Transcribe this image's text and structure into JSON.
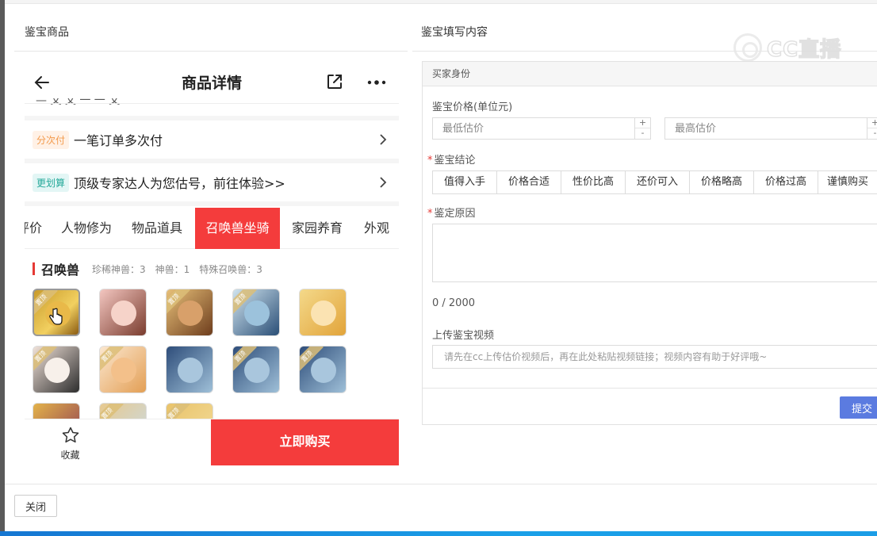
{
  "left_section": {
    "title": "鉴宝商品"
  },
  "right_section": {
    "title": "鉴宝填写内容"
  },
  "watermark": {
    "text": "CC直播"
  },
  "phone": {
    "nav_title": "商品详情",
    "cutoff_text": "— 乂 乂 一 一 乂",
    "rows": [
      {
        "tag": "分次付",
        "text": "一笔订单多次付"
      },
      {
        "tag": "更划算",
        "text": "顶级专家达人为您估号，前往体验>>"
      }
    ],
    "tabs": [
      "评价",
      "人物修为",
      "物品道具",
      "召唤兽坐骑",
      "家园养育",
      "外观"
    ],
    "active_tab": "召唤兽坐骑",
    "pet_section": {
      "title": "召唤兽",
      "stats": [
        "珍稀神兽：3",
        "神兽：1",
        "特殊召唤兽：3"
      ],
      "ribbon_label": "置顶"
    },
    "favorite_label": "收藏",
    "buy_label": "立即购买"
  },
  "form": {
    "header": "买家身份",
    "price_label": "鉴宝价格(单位元)",
    "min_placeholder": "最低估价",
    "max_placeholder": "最高估价",
    "plus": "+",
    "minus": "-",
    "conclusion_label": "鉴宝结论",
    "conclusion_options": [
      "值得入手",
      "价格合适",
      "性价比高",
      "还价可入",
      "价格略高",
      "价格过高",
      "谨慎购买"
    ],
    "reason_label": "鉴定原因",
    "counter": "0 / 2000",
    "video_label": "上传鉴宝视频",
    "video_placeholder": "请先在cc上传估价视频后，再在此处粘贴视频链接；视频内容有助于好评哦~",
    "submit_label": "提交",
    "required_mark": "*"
  },
  "close_label": "关闭",
  "colors": {
    "accent_red": "#f43c3c",
    "submit_blue": "#5b7be0"
  }
}
